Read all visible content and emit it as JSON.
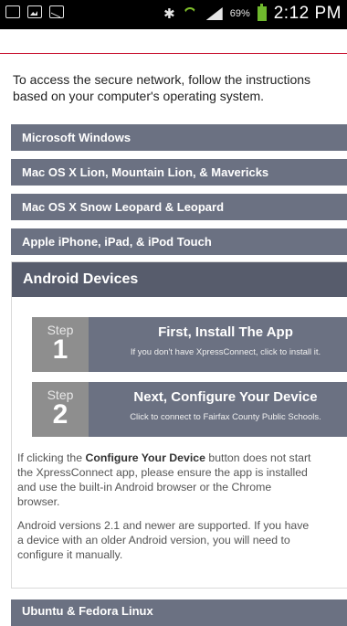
{
  "status_bar": {
    "battery_pct": "69%",
    "time": "2:12 PM",
    "icons": [
      "usb-icon",
      "image-icon",
      "mail-icon",
      "bluetooth-icon",
      "wifi-icon",
      "signal-icon",
      "battery-icon"
    ]
  },
  "intro": {
    "line1": "To access the secure network, follow the instructions",
    "line2": "based on your computer's operating system."
  },
  "accordion": {
    "windows": "Microsoft Windows",
    "mac_lion": "Mac OS X Lion, Mountain Lion, & Mavericks",
    "mac_snow": "Mac OS X Snow Leopard & Leopard",
    "apple_ios": "Apple iPhone, iPad, & iPod Touch",
    "android": "Android Devices",
    "ubuntu": "Ubuntu & Fedora Linux"
  },
  "steps": [
    {
      "word": "Step",
      "number": "1",
      "title": "First, Install The App",
      "subtitle": "If you don't have XpressConnect, click to install it."
    },
    {
      "word": "Step",
      "number": "2",
      "title": "Next, Configure Your Device",
      "subtitle": "Click to connect to Fairfax County Public Schools."
    }
  ],
  "para1": {
    "l1_pre": "If clicking the ",
    "l1_bold": "Configure Your Device",
    "l1_post": " button does not start",
    "l2": "the XpressConnect app, please ensure the app is installed",
    "l3": "and use the built-in Android browser or the Chrome",
    "l4": "browser."
  },
  "para2": {
    "l1": "Android versions 2.1 and newer are supported. If you have",
    "l2": "a device with an older Android version, you will need to",
    "l3": "configure it manually."
  },
  "colors": {
    "bar": "#6b7182",
    "section_header": "#575c6c",
    "step_box": "#8e8e8e",
    "accent_red": "#c8102e"
  }
}
